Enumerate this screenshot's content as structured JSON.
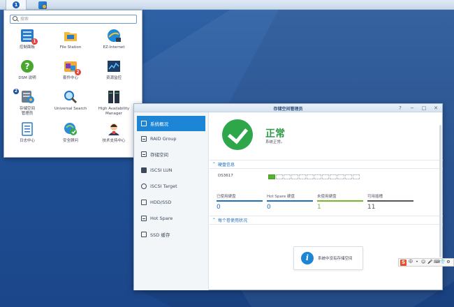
{
  "taskbar": {
    "main_menu_glyph": "1"
  },
  "start_menu": {
    "search_placeholder": "搜索",
    "apps": [
      {
        "label": "控制面板",
        "icon": "control-panel-icon",
        "badge": "1"
      },
      {
        "label": "File Station",
        "icon": "folder-icon",
        "badge": ""
      },
      {
        "label": "EZ-Internet",
        "icon": "globe-icon",
        "badge": ""
      },
      {
        "label": "DSM 说明",
        "icon": "help-icon",
        "badge": ""
      },
      {
        "label": "套件中心",
        "icon": "package-icon",
        "badge": "2"
      },
      {
        "label": "资源监控",
        "icon": "resource-monitor-icon",
        "badge": ""
      },
      {
        "label": "存储空间\n管理员",
        "icon": "storage-manager-icon",
        "badge": "",
        "pointer": "2"
      },
      {
        "label": "Universal Search",
        "icon": "magnifier-icon",
        "badge": ""
      },
      {
        "label": "High Availability\nManager",
        "icon": "server-icon",
        "badge": ""
      },
      {
        "label": "日志中心",
        "icon": "log-center-icon",
        "badge": ""
      },
      {
        "label": "安全顾问",
        "icon": "security-advisor-icon",
        "badge": ""
      },
      {
        "label": "技术支持中心",
        "icon": "support-center-icon",
        "badge": ""
      }
    ]
  },
  "window": {
    "title": "存储空间管理员",
    "controls": [
      "?",
      "−",
      "□",
      "✕"
    ],
    "sidebar": [
      {
        "label": "系统概况",
        "active": true
      },
      {
        "label": "RAID Group",
        "active": false
      },
      {
        "label": "存储空间",
        "active": false
      },
      {
        "label": "iSCSI LUN",
        "active": false
      },
      {
        "label": "iSCSI Target",
        "active": false
      },
      {
        "label": "HDD/SSD",
        "active": false
      },
      {
        "label": "Hot Spare",
        "active": false
      },
      {
        "label": "SSD 缓存",
        "active": false
      }
    ],
    "status": {
      "big": "正常",
      "sub": "系统正常。"
    },
    "disk_section": {
      "header": "硬盘信息",
      "model": "DS3617",
      "slots_used": 1,
      "slots_total": 12
    },
    "stats": [
      {
        "label": "已使用硬盘",
        "value": "0",
        "color": "#1d6fc2"
      },
      {
        "label": "Hot Spare 硬盘",
        "value": "0",
        "color": "#1d6fc2"
      },
      {
        "label": "未使用硬盘",
        "value": "1",
        "color": "#7ab62d"
      },
      {
        "label": "可用插槽",
        "value": "11",
        "color": "#555555"
      }
    ],
    "volume_section": {
      "header": "每个卷使用状况"
    },
    "empty_message": "系统中没有存储空间"
  },
  "ime": {
    "logo": "S",
    "items": [
      "中",
      "•",
      "☺",
      "🎤",
      "⌨",
      "👕",
      "⚙"
    ]
  }
}
